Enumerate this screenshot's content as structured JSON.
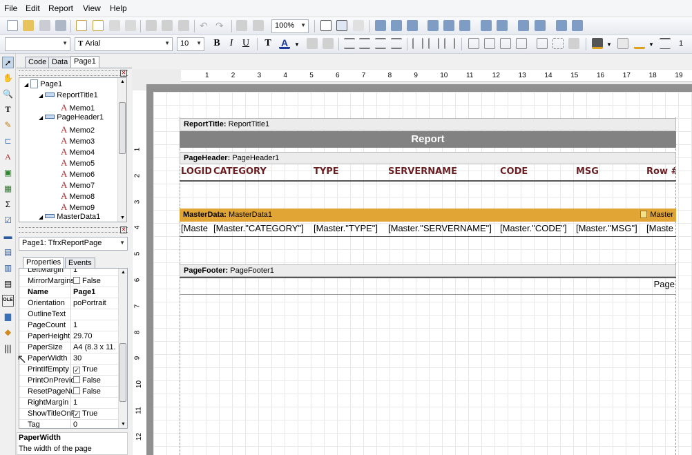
{
  "menu": [
    "File",
    "Edit",
    "Report",
    "View",
    "Help"
  ],
  "toolbar": {
    "zoom": "100%",
    "font_name": "Arial",
    "font_size": "10",
    "style_box": "",
    "frame_width": "1"
  },
  "tabs": [
    "Code",
    "Data",
    "Page1"
  ],
  "tree": {
    "items": [
      {
        "label": "Page1",
        "icon": "page-icon"
      },
      {
        "label": "ReportTitle1",
        "icon": "band-icon"
      },
      {
        "label": "Memo1",
        "icon": "memo-icon"
      },
      {
        "label": "PageHeader1",
        "icon": "band-icon"
      },
      {
        "label": "Memo2",
        "icon": "memo-icon"
      },
      {
        "label": "Memo3",
        "icon": "memo-icon"
      },
      {
        "label": "Memo4",
        "icon": "memo-icon"
      },
      {
        "label": "Memo5",
        "icon": "memo-icon"
      },
      {
        "label": "Memo6",
        "icon": "memo-icon"
      },
      {
        "label": "Memo7",
        "icon": "memo-icon"
      },
      {
        "label": "Memo8",
        "icon": "memo-icon"
      },
      {
        "label": "Memo9",
        "icon": "memo-icon"
      },
      {
        "label": "MasterData1",
        "icon": "band-icon"
      }
    ]
  },
  "object_selector": "Page1: TfrxReportPage",
  "inspector_tabs": [
    "Properties",
    "Events"
  ],
  "properties": [
    {
      "name": "LeftMargin",
      "value": "1",
      "checkbox": null,
      "bold": false
    },
    {
      "name": "MirrorMargins",
      "value": "False",
      "checkbox": false,
      "bold": false
    },
    {
      "name": "Name",
      "value": "Page1",
      "checkbox": null,
      "bold": true
    },
    {
      "name": "Orientation",
      "value": "poPortrait",
      "checkbox": null,
      "bold": false
    },
    {
      "name": "OutlineText",
      "value": "",
      "checkbox": null,
      "bold": false
    },
    {
      "name": "PageCount",
      "value": "1",
      "checkbox": null,
      "bold": false
    },
    {
      "name": "PaperHeight",
      "value": "29.70",
      "checkbox": null,
      "bold": false
    },
    {
      "name": "PaperSize",
      "value": "A4 (8.3 x 11.",
      "checkbox": null,
      "bold": false
    },
    {
      "name": "PaperWidth",
      "value": "30",
      "checkbox": null,
      "bold": false
    },
    {
      "name": "PrintIfEmpty",
      "value": "True",
      "checkbox": true,
      "bold": false
    },
    {
      "name": "PrintOnPrevio",
      "value": "False",
      "checkbox": false,
      "bold": false
    },
    {
      "name": "ResetPageNu",
      "value": "False",
      "checkbox": false,
      "bold": false
    },
    {
      "name": "RightMargin",
      "value": "1",
      "checkbox": null,
      "bold": false
    },
    {
      "name": "ShowTitleOnP",
      "value": "True",
      "checkbox": true,
      "bold": false
    },
    {
      "name": "Tag",
      "value": "0",
      "checkbox": null,
      "bold": false
    }
  ],
  "help": {
    "title": "PaperWidth",
    "text": "The width of the page"
  },
  "ruler": {
    "h_ticks": [
      "1",
      "2",
      "3",
      "4",
      "5",
      "6",
      "7",
      "8",
      "9",
      "10",
      "11",
      "12",
      "13",
      "14",
      "15",
      "16",
      "17",
      "18",
      "19"
    ],
    "v_ticks": [
      "1",
      "2",
      "3",
      "4",
      "5",
      "6",
      "7",
      "8",
      "9",
      "10",
      "11",
      "12"
    ]
  },
  "report": {
    "title_band": {
      "type": "ReportTitle:",
      "name": "ReportTitle1",
      "text": "Report"
    },
    "header_band": {
      "type": "PageHeader:",
      "name": "PageHeader1"
    },
    "columns": [
      "LOGID",
      "CATEGORY",
      "TYPE",
      "SERVERNAME",
      "CODE",
      "MSG",
      "Row #"
    ],
    "master_band": {
      "type": "MasterData:",
      "name": "MasterData1",
      "datasource": "Master"
    },
    "master_cells": [
      "[Maste",
      "[Master.\"CATEGORY\"]",
      "[Master.\"TYPE\"]",
      "[Master.\"SERVERNAME\"]",
      "[Master.\"CODE\"]",
      "[Master.\"MSG\"]",
      "[Maste"
    ],
    "footer_band": {
      "type": "PageFooter:",
      "name": "PageFooter1",
      "text": "Page"
    }
  },
  "colors": {
    "title_bar": "#828282",
    "master_band": "#e0a535",
    "header_text": "#6b1e22"
  }
}
